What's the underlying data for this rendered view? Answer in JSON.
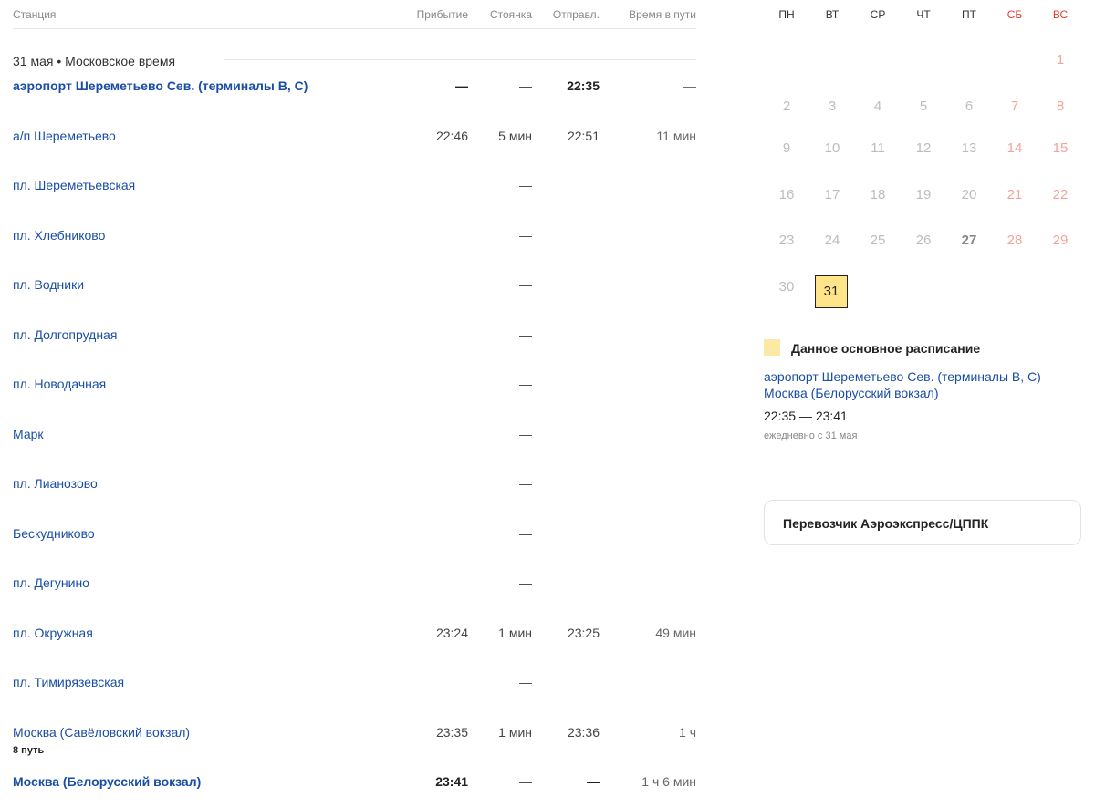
{
  "table": {
    "headers": {
      "station": "Станция",
      "arrival": "Прибытие",
      "stop": "Стоянка",
      "departure": "Отправл.",
      "travel": "Время в пути"
    },
    "date_line": "31 мая  •  Московское время",
    "rows": [
      {
        "name": "аэропорт Шереметьево Сев. (терминалы B, C)",
        "bold": true,
        "arrival": "—",
        "stop": "—",
        "departure": "22:35",
        "travel": "—",
        "platform": ""
      },
      {
        "name": "а/п Шереметьево",
        "bold": false,
        "arrival": "22:46",
        "stop": "5 мин",
        "departure": "22:51",
        "travel": "11 мин",
        "platform": ""
      },
      {
        "name": "пл. Шереметьевская",
        "bold": false,
        "arrival": "",
        "stop": "—",
        "departure": "",
        "travel": "",
        "platform": ""
      },
      {
        "name": "пл. Хлебниково",
        "bold": false,
        "arrival": "",
        "stop": "—",
        "departure": "",
        "travel": "",
        "platform": ""
      },
      {
        "name": "пл. Водники",
        "bold": false,
        "arrival": "",
        "stop": "—",
        "departure": "",
        "travel": "",
        "platform": ""
      },
      {
        "name": "пл. Долгопрудная",
        "bold": false,
        "arrival": "",
        "stop": "—",
        "departure": "",
        "travel": "",
        "platform": ""
      },
      {
        "name": "пл. Новодачная",
        "bold": false,
        "arrival": "",
        "stop": "—",
        "departure": "",
        "travel": "",
        "platform": ""
      },
      {
        "name": "Марк",
        "bold": false,
        "arrival": "",
        "stop": "—",
        "departure": "",
        "travel": "",
        "platform": ""
      },
      {
        "name": "пл. Лианозово",
        "bold": false,
        "arrival": "",
        "stop": "—",
        "departure": "",
        "travel": "",
        "platform": ""
      },
      {
        "name": "Бескудниково",
        "bold": false,
        "arrival": "",
        "stop": "—",
        "departure": "",
        "travel": "",
        "platform": ""
      },
      {
        "name": "пл. Дегунино",
        "bold": false,
        "arrival": "",
        "stop": "—",
        "departure": "",
        "travel": "",
        "platform": ""
      },
      {
        "name": "пл. Окружная",
        "bold": false,
        "arrival": "23:24",
        "stop": "1 мин",
        "departure": "23:25",
        "travel": "49 мин",
        "platform": ""
      },
      {
        "name": "пл. Тимирязевская",
        "bold": false,
        "arrival": "",
        "stop": "—",
        "departure": "",
        "travel": "",
        "platform": ""
      },
      {
        "name": "Москва (Савёловский вокзал)",
        "bold": false,
        "arrival": "23:35",
        "stop": "1 мин",
        "departure": "23:36",
        "travel": "1 ч",
        "platform": "8 путь"
      },
      {
        "name": "Москва (Белорусский вокзал)",
        "bold": true,
        "arrival": "23:41",
        "stop": "—",
        "departure": "—",
        "travel": "1 ч 6 мин",
        "platform": ""
      }
    ]
  },
  "calendar": {
    "weekdays": [
      "ПН",
      "ВТ",
      "СР",
      "ЧТ",
      "ПТ",
      "СБ",
      "ВС"
    ],
    "weeks": [
      [
        "",
        "",
        "",
        "",
        "",
        "",
        "1"
      ],
      [
        "2",
        "3",
        "4",
        "5",
        "6",
        "7",
        "8"
      ],
      [
        "9",
        "10",
        "11",
        "12",
        "13",
        "14",
        "15"
      ],
      [
        "16",
        "17",
        "18",
        "19",
        "20",
        "21",
        "22"
      ],
      [
        "23",
        "24",
        "25",
        "26",
        "27",
        "28",
        "29"
      ],
      [
        "30",
        "31",
        "",
        "",
        "",
        "",
        ""
      ]
    ],
    "today": "27",
    "selected": "31"
  },
  "legend": {
    "title": "Данное основное расписание",
    "route": "аэропорт Шереметьево Сев. (терминалы B, C) — Москва (Белорусский вокзал)",
    "times": "22:35 — 23:41",
    "period": "ежедневно с 31 мая"
  },
  "carrier": {
    "label": "Перевозчик Аэроэкспресс/ЦППК"
  },
  "colors": {
    "link": "#1a4ea5",
    "weekend": "#e03b2c",
    "selected_day": "#ffe58a",
    "legend_swatch": "#fbe9a4"
  }
}
